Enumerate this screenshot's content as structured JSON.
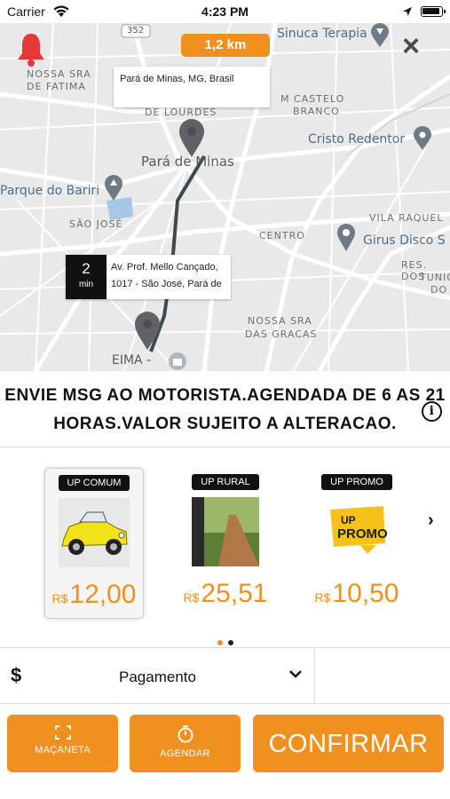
{
  "status_bar": {
    "carrier": "Carrier",
    "time": "4:23 PM"
  },
  "map": {
    "distance_badge": "1,2 km",
    "origin_address": "Pará de Minas, MG, Brasil",
    "eta": {
      "value": "2",
      "unit": "min"
    },
    "destination_address_line1": "Av. Prof. Mello Cançado,",
    "destination_address_line2": "1017 - São José, Pará de",
    "labels": {
      "route_shield": "352",
      "nossa_sra_fatima_1": "NOSSA SRA",
      "nossa_sra_fatima_2": "DE FATIMA",
      "de_lourdes": "DE LOURDES",
      "castelo_1": "M CASTELO",
      "castelo_2": "BRANCO",
      "para_de_minas": "Pará de Minas",
      "parque_do_bariri": "Parque do Bariri",
      "sao_jose": "SÃO JOSÉ",
      "centro": "CENTRO",
      "vila_raquel": "VILA RAQUEL",
      "res_dos_1": "RES. DOS",
      "res_dos_2": "TUNIC",
      "res_dos_3": "DO",
      "nossa_sra_gracas_1": "NOSSA SRA",
      "nossa_sra_gracas_2": "DAS GRACAS",
      "eima": "EIMA -",
      "sinuca_terapia": "Sinuca Terapia",
      "cristo_redentor": "Cristo Redentor",
      "girus_disco": "Girus Disco S"
    }
  },
  "message": {
    "line1": "ENVIE MSG AO MOTORISTA.AGENDADA DE 6 AS 21",
    "line2": "HORAS.VALOR SUJEITO A ALTERACAO."
  },
  "categories": [
    {
      "name": "UP COMUM",
      "currency": "R$",
      "price": "12,00",
      "selected": true
    },
    {
      "name": "UP RURAL",
      "currency": "R$",
      "price": "25,51",
      "selected": false
    },
    {
      "name": "UP PROMO",
      "currency": "R$",
      "price": "10,50",
      "selected": false,
      "image_text_1": "UP",
      "image_text_2": "PROMO"
    }
  ],
  "pagination": {
    "pages": 2,
    "current": 1
  },
  "payment": {
    "symbol": "$",
    "label": "Pagamento"
  },
  "buttons": {
    "macaneta": "MAÇANETA",
    "agendar": "AGENDAR",
    "confirmar": "CONFIRMAR"
  },
  "colors": {
    "accent": "#f0901e",
    "map_bg": "#e9e9e9",
    "bell": "#e53935"
  }
}
